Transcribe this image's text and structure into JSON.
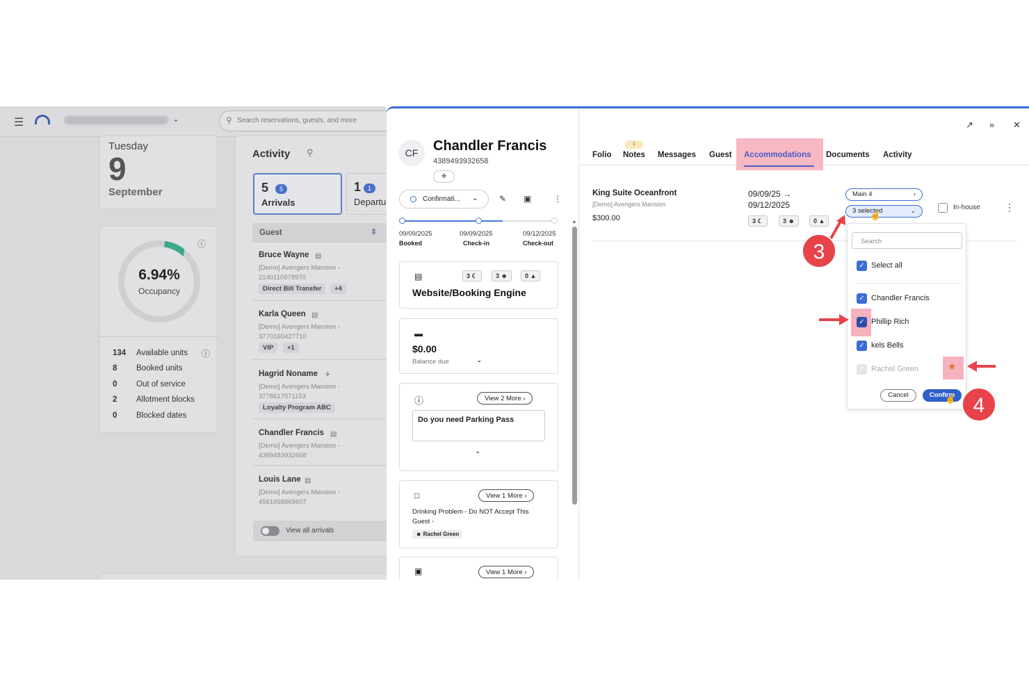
{
  "topbar": {
    "menu_icon": "hamburger-icon",
    "search_placeholder": "Search reservations, guests, and more"
  },
  "date": {
    "weekday": "Tuesday",
    "day": "9",
    "month": "September"
  },
  "occupancy": {
    "percent": "6.94%",
    "label": "Occupancy",
    "fill_fraction": 0.0694,
    "stats": [
      {
        "num": "134",
        "label": "Available units"
      },
      {
        "num": "8",
        "label": "Booked units"
      },
      {
        "num": "0",
        "label": "Out of service"
      },
      {
        "num": "2",
        "label": "Allotment blocks"
      },
      {
        "num": "0",
        "label": "Blocked dates"
      }
    ]
  },
  "activity": {
    "title": "Activity",
    "arrivals_count": "5",
    "arrivals_badge": "5",
    "arrivals_label": "Arrivals",
    "departures_count": "1",
    "departures_badge": "1",
    "departures_label": "Departu",
    "guest_header": "Guest",
    "guests": [
      {
        "name": "Bruce Wayne",
        "prop": "[Demo] Avengers Mansion -",
        "id": "2140110978970",
        "tag": "Direct Bill Transfer",
        "more": "+4"
      },
      {
        "name": "Karla Queen",
        "prop": "[Demo] Avengers Mansion -",
        "id": "3770160427710",
        "tag": "VIP",
        "more": "+1"
      },
      {
        "name": "Hagrid Noname",
        "prop": "[Demo] Avengers Mansion -",
        "id": "3778617071153",
        "tag": "Loyalty Program ABC",
        "more": ""
      },
      {
        "name": "Chandler Francis",
        "prop": "[Demo] Avengers Mansion -",
        "id": "4389493932658",
        "tag": "",
        "more": ""
      },
      {
        "name": "Louis Lane",
        "prop": "[Demo] Avengers Mansion -",
        "id": "4561668869607",
        "tag": "",
        "more": ""
      }
    ],
    "view_all": "View all arrivals"
  },
  "guest": {
    "initials": "CF",
    "name": "Chandler Francis",
    "phone": "4389493932658",
    "status": "Confirmati...",
    "timeline": [
      {
        "date": "09/09/2025",
        "label": "Booked"
      },
      {
        "date": "09/09/2025",
        "label": "Check-in"
      },
      {
        "date": "09/12/2025",
        "label": "Check-out"
      }
    ],
    "source": {
      "nights": "3",
      "guests": "3",
      "pets": "0",
      "name": "Website/Booking Engine"
    },
    "balance": {
      "amount": "$0.00",
      "label": "Balance due"
    },
    "question": {
      "view_more": "View 2 More",
      "text": "Do you need Parking Pass"
    },
    "note": {
      "view_more": "View 1 More",
      "text": "Drinking Problem - Do NOT Accept This Guest -",
      "author": "Rachel Green"
    },
    "bed": {
      "view_more": "View 1 More"
    }
  },
  "tabs": [
    {
      "label": "Folio"
    },
    {
      "label": "Notes"
    },
    {
      "label": "Messages"
    },
    {
      "label": "Guest"
    },
    {
      "label": "Accommodations"
    },
    {
      "label": "Documents"
    },
    {
      "label": "Activity"
    }
  ],
  "notes_badge": "1",
  "accommodation": {
    "room": "King Suite Oceanfront",
    "prop": "[Demo] Avengers Mansion",
    "price": "$300.00",
    "date_from": "09/09/25 →",
    "date_to": "09/12/2025",
    "nights": "3",
    "guests": "3",
    "pets": "0",
    "unit": "Main 4",
    "selected": "3 selected",
    "inhouse": "In-house"
  },
  "dropdown": {
    "search": "Search",
    "select_all": "Select all",
    "options": [
      {
        "label": "Chandler Francis",
        "checked": true
      },
      {
        "label": "Phillip Rich",
        "checked": true
      },
      {
        "label": "kels Bells",
        "checked": true
      },
      {
        "label": "Rachel Green",
        "checked": false
      }
    ],
    "cancel": "Cancel",
    "confirm": "Confirm"
  },
  "annotations": {
    "step3": "3",
    "step4": "4"
  },
  "colors": {
    "accent": "#3b6cd4",
    "highlight": "#f5a3b3",
    "step": "#e8434b"
  }
}
